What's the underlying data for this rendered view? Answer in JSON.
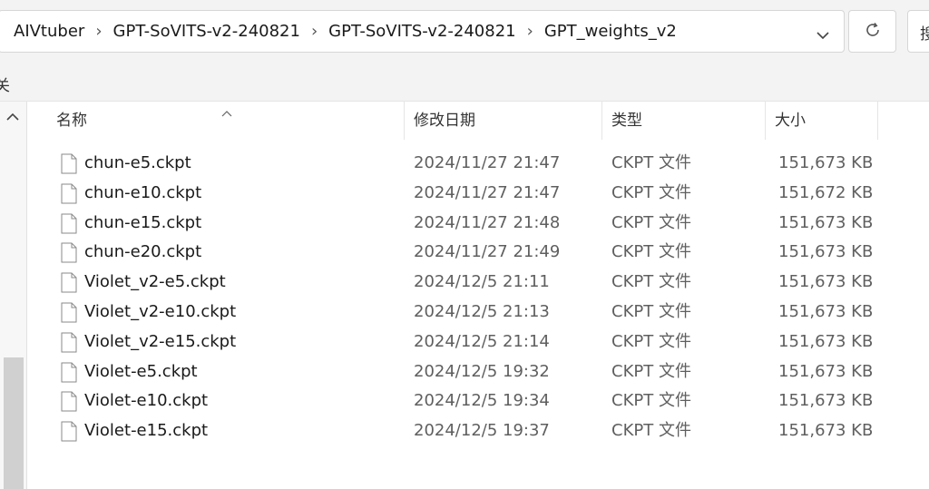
{
  "address_bar": {
    "breadcrumbs": [
      "AIVtuber",
      "GPT-SoVITS-v2-240821",
      "GPT-SoVITS-v2-240821",
      "GPT_weights_v2"
    ],
    "separator": "›"
  },
  "search": {
    "partial_text": "搜"
  },
  "command_bar": {
    "partial_label": "关"
  },
  "columns": [
    {
      "key": "name",
      "label": "名称"
    },
    {
      "key": "modified",
      "label": "修改日期"
    },
    {
      "key": "type",
      "label": "类型"
    },
    {
      "key": "size",
      "label": "大小"
    }
  ],
  "files": [
    {
      "name": "chun-e5.ckpt",
      "modified": "2024/11/27 21:47",
      "type": "CKPT 文件",
      "size": "151,673 KB"
    },
    {
      "name": "chun-e10.ckpt",
      "modified": "2024/11/27 21:47",
      "type": "CKPT 文件",
      "size": "151,672 KB"
    },
    {
      "name": "chun-e15.ckpt",
      "modified": "2024/11/27 21:48",
      "type": "CKPT 文件",
      "size": "151,673 KB"
    },
    {
      "name": "chun-e20.ckpt",
      "modified": "2024/11/27 21:49",
      "type": "CKPT 文件",
      "size": "151,673 KB"
    },
    {
      "name": "Violet_v2-e5.ckpt",
      "modified": "2024/12/5 21:11",
      "type": "CKPT 文件",
      "size": "151,673 KB"
    },
    {
      "name": "Violet_v2-e10.ckpt",
      "modified": "2024/12/5 21:13",
      "type": "CKPT 文件",
      "size": "151,673 KB"
    },
    {
      "name": "Violet_v2-e15.ckpt",
      "modified": "2024/12/5 21:14",
      "type": "CKPT 文件",
      "size": "151,673 KB"
    },
    {
      "name": "Violet-e5.ckpt",
      "modified": "2024/12/5 19:32",
      "type": "CKPT 文件",
      "size": "151,673 KB"
    },
    {
      "name": "Violet-e10.ckpt",
      "modified": "2024/12/5 19:34",
      "type": "CKPT 文件",
      "size": "151,673 KB"
    },
    {
      "name": "Violet-e15.ckpt",
      "modified": "2024/12/5 19:37",
      "type": "CKPT 文件",
      "size": "151,673 KB"
    }
  ],
  "icons": {
    "dropdown": "chevron-down-icon",
    "refresh": "refresh-icon",
    "sort": "sort-ascending-icon",
    "file": "file-icon",
    "nav_scroll_up": "chevron-up-icon"
  }
}
